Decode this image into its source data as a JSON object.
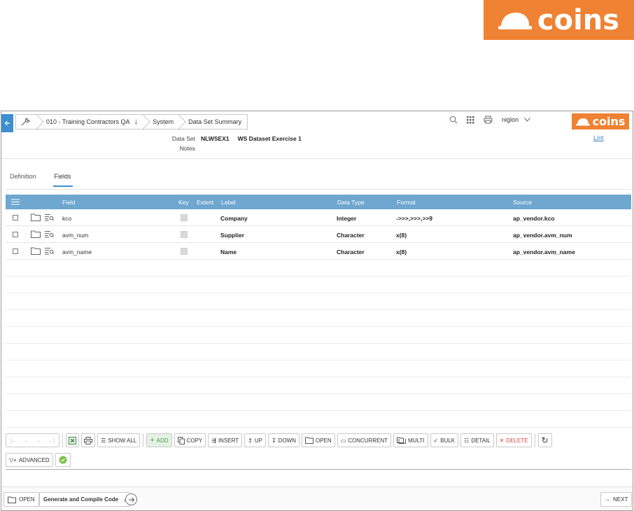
{
  "brand": {
    "name": "coins",
    "color": "#ef8233"
  },
  "breadcrumb": [
    {
      "label": "010 - Training Contractors QA",
      "icon": "arrow-down-icon"
    },
    {
      "label": "System"
    },
    {
      "label": "Data Set Summary"
    }
  ],
  "header": {
    "user": "niglon",
    "lint": "Lint"
  },
  "dataset": {
    "dataset_label": "Data Set",
    "dataset_code": "NLWSEX1",
    "dataset_name": "WS Dataset Exercise 1",
    "notes_label": "Notes"
  },
  "tabs": [
    {
      "label": "Definition",
      "active": false
    },
    {
      "label": "Fields",
      "active": true
    }
  ],
  "grid": {
    "columns": [
      "Field",
      "Key",
      "Extent",
      "Label",
      "Data Type",
      "Format",
      "Source"
    ],
    "rows": [
      {
        "field": "kco",
        "label": "Company",
        "data_type": "Integer",
        "format": "->>>,>>>,>>9",
        "source": "ap_vendor.kco"
      },
      {
        "field": "avm_num",
        "label": "Supplier",
        "data_type": "Character",
        "format": "x(8)",
        "source": "ap_vendor.avm_num"
      },
      {
        "field": "avm_name",
        "label": "Name",
        "data_type": "Character",
        "format": "x(8)",
        "source": "ap_vendor.avm_name"
      }
    ]
  },
  "toolbar": {
    "show_all": "SHOW ALL",
    "add": "ADD",
    "copy": "COPY",
    "insert": "INSERT",
    "up": "UP",
    "down": "DOWN",
    "open": "OPEN",
    "concurrent": "CONCURRENT",
    "multi": "MULTI",
    "bulk": "BULK",
    "detail": "DETAIL",
    "delete": "DELETE",
    "advanced": "ADVANCED"
  },
  "footer": {
    "open": "OPEN",
    "generate": "Generate and Compile Code",
    "next": "NEXT"
  },
  "colors": {
    "accent": "#3d8fd0",
    "grid_header": "#6ea7cf",
    "add_green": "#4a9a4a",
    "delete_red": "#dd4444"
  }
}
